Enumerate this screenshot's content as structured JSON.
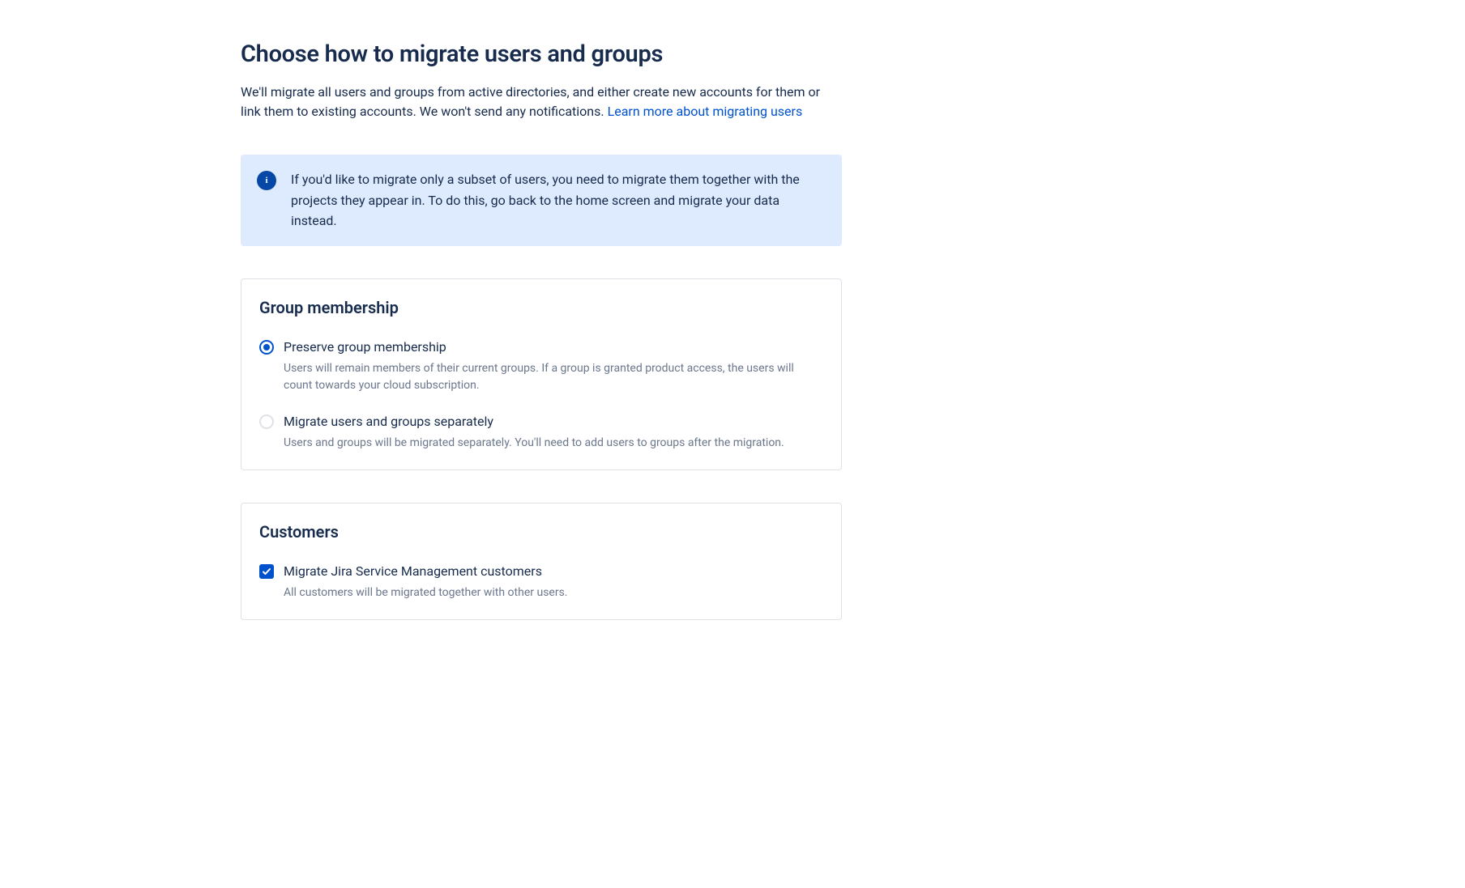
{
  "page": {
    "title": "Choose how to migrate users and groups",
    "description_prefix": "We'll migrate all users and groups from active directories, and either create new accounts for them or link them to existing accounts. We won't send any notifications. ",
    "learn_more_link": "Learn more about migrating users"
  },
  "info_banner": {
    "icon_letter": "i",
    "text": "If you'd like to migrate only a subset of users, you need to migrate them together with the projects they appear in. To do this, go back to the home screen and migrate your data instead."
  },
  "group_membership": {
    "title": "Group membership",
    "options": [
      {
        "label": "Preserve group membership",
        "desc": "Users will remain members of their current groups. If a group is granted product access, the users will count towards your cloud subscription.",
        "selected": true
      },
      {
        "label": "Migrate users and groups separately",
        "desc": "Users and groups will be migrated separately. You'll need to add users to groups after the migration.",
        "selected": false
      }
    ]
  },
  "customers": {
    "title": "Customers",
    "option": {
      "label": "Migrate Jira Service Management customers",
      "desc": "All customers will be migrated together with other users.",
      "checked": true
    }
  }
}
